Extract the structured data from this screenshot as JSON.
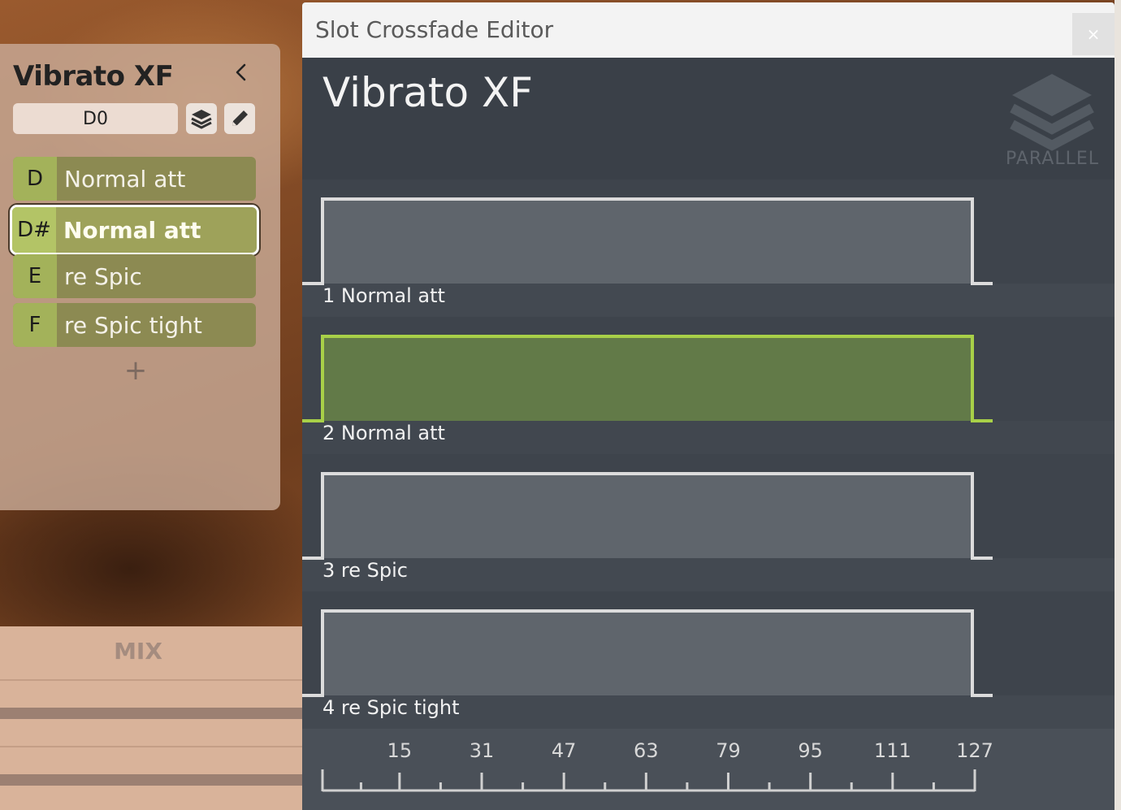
{
  "slot_panel": {
    "title": "Vibrato XF",
    "key": "D0",
    "collapse_icon": "chevron-left-icon",
    "layers_icon": "layers-icon",
    "edit_icon": "pencil-icon",
    "add_label": "+",
    "articulations": [
      {
        "note": "D",
        "name": "Normal att",
        "selected": false
      },
      {
        "note": "D#",
        "name": "Normal att",
        "selected": true
      },
      {
        "note": "E",
        "name": "re Spic",
        "selected": false
      },
      {
        "note": "F",
        "name": "re Spic tight",
        "selected": false
      }
    ]
  },
  "mix": {
    "label": "MIX"
  },
  "editor": {
    "window_title": "Slot Crossfade Editor",
    "close_label": "×",
    "heading": "Vibrato XF",
    "mode_label": "PARALLEL",
    "lanes": [
      {
        "label": "1 Normal att",
        "range": [
          0,
          127
        ],
        "active": false
      },
      {
        "label": "2 Normal att",
        "range": [
          0,
          127
        ],
        "active": true
      },
      {
        "label": "3 re Spic",
        "range": [
          0,
          127
        ],
        "active": false
      },
      {
        "label": "4 re Spic tight",
        "range": [
          0,
          127
        ],
        "active": false
      }
    ],
    "ruler": {
      "min": 0,
      "max": 127,
      "labels": [
        "15",
        "31",
        "47",
        "63",
        "79",
        "95",
        "111",
        "127"
      ]
    },
    "colors": {
      "active_fill": "#627a48",
      "active_stroke": "#a8d048",
      "inactive_fill": "#5f656c",
      "inactive_stroke": "#dcdcdc"
    }
  }
}
